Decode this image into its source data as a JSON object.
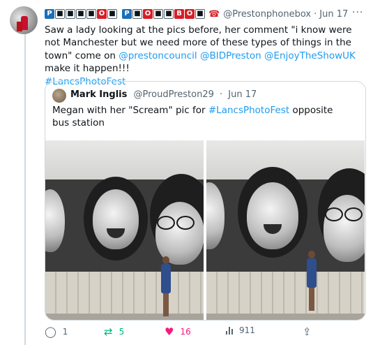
{
  "tweet": {
    "display_name_boxes": [
      "P",
      "■",
      "■",
      "■",
      "■",
      "O",
      "■",
      " ",
      "P",
      "■",
      "O",
      "■",
      "■",
      "B",
      "O",
      "■"
    ],
    "handle": "@Prestonphonebox",
    "dot": "·",
    "date": "Jun 17",
    "more_icon": "···",
    "text_part1": "Saw a lady looking at the pics before, her comment \"i know were not Manchester but we need more of these types of things in the town\" come on ",
    "mention1": "@prestoncouncil",
    "mention2": "@BIDPreston",
    "mention3": "@EnjoyTheShowUK",
    "text_part2": " make it happen!!!",
    "hashtag": "#LancsPhotoFest"
  },
  "quote": {
    "name": "Mark Inglis",
    "handle": "@ProudPreston29",
    "dot": "·",
    "date": "Jun 17",
    "text_part1": "Megan with her \"Scream\" pic for ",
    "hashtag": "#LancsPhotoFest",
    "text_part2": " opposite bus station"
  },
  "actions": {
    "replies": "1",
    "retweets": "5",
    "likes": "16",
    "views": "911"
  },
  "colors": {
    "link": "#1d9bf0",
    "retweet": "#00ba7c",
    "like": "#f91880",
    "muted": "#536471",
    "border": "#cfd9de"
  },
  "icons": [
    "reply-icon",
    "retweet-icon",
    "heart-icon",
    "views-icon",
    "share-icon",
    "phone-icon",
    "more-icon"
  ]
}
